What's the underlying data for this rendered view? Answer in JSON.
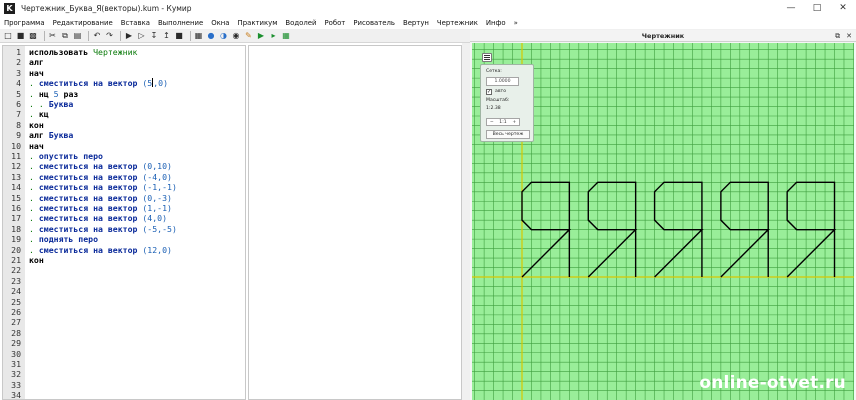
{
  "window": {
    "title": "Чертежник_Буква_Я(векторы).kum - Кумир",
    "app_icon": "K",
    "controls": [
      "minimize-icon",
      "maximize-icon",
      "close-icon"
    ]
  },
  "menu": [
    "Программа",
    "Редактирование",
    "Вставка",
    "Выполнение",
    "Окна",
    "Практикум",
    "Водолей",
    "Робот",
    "Рисователь",
    "Вертун",
    "Чертежник",
    "Инфо",
    "»"
  ],
  "toolbar_icons": [
    "new-file-icon",
    "open-file-icon",
    "save-icon",
    "cut-icon",
    "copy-icon",
    "paste-icon",
    "undo-icon",
    "redo-icon",
    "run-icon",
    "run-step-icon",
    "step-in-icon",
    "step-out-icon",
    "stop-icon",
    "grid-icon",
    "globe-icon",
    "globe-icon",
    "camera-icon",
    "drawing-icon",
    "run-green-icon",
    "step-green-icon",
    "grid-green-icon"
  ],
  "editor": {
    "lines": [
      [
        {
          "t": "использовать ",
          "c": "kw"
        },
        {
          "t": "Чертежник",
          "c": "nm"
        }
      ],
      [
        {
          "t": "алг",
          "c": "kw"
        }
      ],
      [
        {
          "t": "нач",
          "c": "kw"
        }
      ],
      [
        {
          "t": ". ",
          "c": "nm"
        },
        {
          "t": "сместиться на вектор ",
          "c": "cmd"
        },
        {
          "t": "(5",
          "c": "num"
        },
        {
          "t": "",
          "c": "cursor"
        },
        {
          "t": ",0)",
          "c": "num"
        }
      ],
      [
        {
          "t": ". ",
          "c": "nm"
        },
        {
          "t": "нц ",
          "c": "kw"
        },
        {
          "t": "5 ",
          "c": "num"
        },
        {
          "t": "раз",
          "c": "kw"
        }
      ],
      [
        {
          "t": ". . ",
          "c": "nm"
        },
        {
          "t": "Буква",
          "c": "cmd"
        }
      ],
      [
        {
          "t": ". ",
          "c": "nm"
        },
        {
          "t": "кц",
          "c": "kw"
        }
      ],
      [
        {
          "t": "кон",
          "c": "kw"
        }
      ],
      [
        {
          "t": "алг ",
          "c": "kw"
        },
        {
          "t": "Буква",
          "c": "cmd"
        }
      ],
      [
        {
          "t": "нач",
          "c": "kw"
        }
      ],
      [
        {
          "t": ". ",
          "c": "nm"
        },
        {
          "t": "опустить перо",
          "c": "cmd"
        }
      ],
      [
        {
          "t": ". ",
          "c": "nm"
        },
        {
          "t": "сместиться на вектор ",
          "c": "cmd"
        },
        {
          "t": "(0,10)",
          "c": "num"
        }
      ],
      [
        {
          "t": ". ",
          "c": "nm"
        },
        {
          "t": "сместиться на вектор ",
          "c": "cmd"
        },
        {
          "t": "(-4,0)",
          "c": "num"
        }
      ],
      [
        {
          "t": ". ",
          "c": "nm"
        },
        {
          "t": "сместиться на вектор ",
          "c": "cmd"
        },
        {
          "t": "(-1,-1)",
          "c": "num"
        }
      ],
      [
        {
          "t": ". ",
          "c": "nm"
        },
        {
          "t": "сместиться на вектор ",
          "c": "cmd"
        },
        {
          "t": "(0,-3)",
          "c": "num"
        }
      ],
      [
        {
          "t": ". ",
          "c": "nm"
        },
        {
          "t": "сместиться на вектор ",
          "c": "cmd"
        },
        {
          "t": "(1,-1)",
          "c": "num"
        }
      ],
      [
        {
          "t": ". ",
          "c": "nm"
        },
        {
          "t": "сместиться на вектор ",
          "c": "cmd"
        },
        {
          "t": "(4,0)",
          "c": "num"
        }
      ],
      [
        {
          "t": ". ",
          "c": "nm"
        },
        {
          "t": "сместиться на вектор ",
          "c": "cmd"
        },
        {
          "t": "(-5,-5)",
          "c": "num"
        }
      ],
      [
        {
          "t": ". ",
          "c": "nm"
        },
        {
          "t": "поднять перо",
          "c": "cmd"
        }
      ],
      [
        {
          "t": ". ",
          "c": "nm"
        },
        {
          "t": "сместиться на вектор ",
          "c": "cmd"
        },
        {
          "t": "(12,0)",
          "c": "num"
        }
      ],
      [
        {
          "t": "кон",
          "c": "kw"
        }
      ],
      [],
      [],
      [],
      [],
      [],
      [],
      [],
      [],
      [],
      [],
      [],
      [],
      []
    ]
  },
  "drawer": {
    "title": "Чертежник",
    "controls": [
      "float-icon",
      "close-icon"
    ],
    "grid_color": "#99ee99",
    "line_color": "#3f9f3f",
    "axis_color": "#d8c800",
    "pen_color": "#000000",
    "panel": {
      "grid_label": "Сетка:",
      "grid_value": "1.0000",
      "auto_label": "авто",
      "auto_checked": "✓",
      "scale_label": "Масштаб:",
      "scale_value": "1:2.38",
      "zoom_minus": "−",
      "zoom_value": "1:1",
      "zoom_plus": "+",
      "fit_button": "Весь чертеж"
    },
    "letter": {
      "start": [
        0,
        0
      ],
      "repeats": 5,
      "vectors": [
        [
          0,
          10
        ],
        [
          -4,
          0
        ],
        [
          -1,
          -1
        ],
        [
          0,
          -3
        ],
        [
          1,
          -1
        ],
        [
          4,
          0
        ],
        [
          -5,
          -5
        ]
      ],
      "step": [
        12,
        0
      ]
    }
  },
  "watermark": "online-otvet.ru"
}
